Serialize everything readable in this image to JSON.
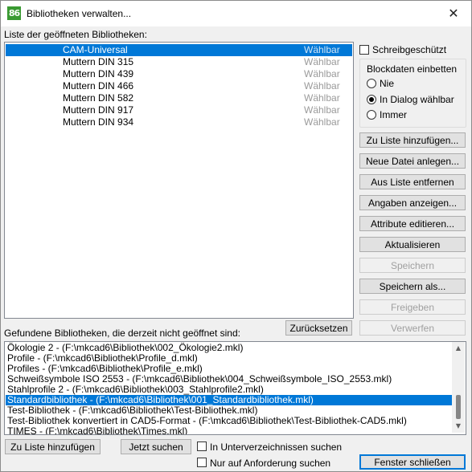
{
  "window": {
    "icon_text": "86",
    "title": "Bibliotheken verwalten...",
    "close_glyph": "✕"
  },
  "opened": {
    "label": "Liste der geöffneten Bibliotheken:",
    "items": [
      {
        "name": "CAM-Universal",
        "state": "Wählbar",
        "selected": true
      },
      {
        "name": "Muttern DIN 315",
        "state": "Wählbar"
      },
      {
        "name": "Muttern DIN 439",
        "state": "Wählbar"
      },
      {
        "name": "Muttern DIN 466",
        "state": "Wählbar"
      },
      {
        "name": "Muttern DIN 582",
        "state": "Wählbar"
      },
      {
        "name": "Muttern DIN 917",
        "state": "Wählbar"
      },
      {
        "name": "Muttern DIN 934",
        "state": "Wählbar"
      }
    ]
  },
  "options": {
    "write_protected": {
      "label": "Schreibgeschützt",
      "checked": false
    },
    "blockdata": {
      "title": "Blockdaten einbetten",
      "nie": "Nie",
      "in_dialog": "In Dialog wählbar",
      "immer": "Immer",
      "selected": "in_dialog"
    }
  },
  "buttons": {
    "add_to_list": "Zu Liste hinzufügen...",
    "new_file": "Neue Datei anlegen...",
    "remove_from_list": "Aus Liste entfernen",
    "show_info": "Angaben anzeigen...",
    "edit_attributes": "Attribute editieren...",
    "refresh": "Aktualisieren",
    "save": "Speichern",
    "save_as": "Speichern als...",
    "release": "Freigeben",
    "discard": "Verwerfen",
    "reset": "Zurücksetzen"
  },
  "found": {
    "label": "Gefundene Bibliotheken, die derzeit nicht geöffnet sind:",
    "items": [
      "Ökologie 2 - (F:\\mkcad6\\Bibliothek\\002_Ökologie2.mkl)",
      "Profile - (F:\\mkcad6\\Bibliothek\\Profile_d.mkl)",
      "Profiles - (F:\\mkcad6\\Bibliothek\\Profile_e.mkl)",
      "Schweißsymbole ISO 2553 - (F:\\mkcad6\\Bibliothek\\004_Schweißsymbole_ISO_2553.mkl)",
      "Stahlprofile 2 - (F:\\mkcad6\\Bibliothek\\003_Stahlprofile2.mkl)",
      "Standardbibliothek - (F:\\mkcad6\\Bibliothek\\001_Standardbibliothek.mkl)",
      "Test-Bibliothek - (F:\\mkcad6\\Bibliothek\\Test-Bibliothek.mkl)",
      "Test-Bibliothek konvertiert in CAD5-Format - (F:\\mkcad6\\Bibliothek\\Test-Bibliothek-CAD5.mkl)",
      "TIMES - (F:\\mkcad6\\Bibliothek\\Times.mkl)"
    ],
    "selected_index": 5
  },
  "bottom": {
    "add_to_list": "Zu Liste hinzufügen",
    "search_now": "Jetzt suchen",
    "search_subdirs": "In Unterverzeichnissen suchen",
    "on_request_only": "Nur auf Anforderung suchen",
    "close_window": "Fenster schließen"
  }
}
